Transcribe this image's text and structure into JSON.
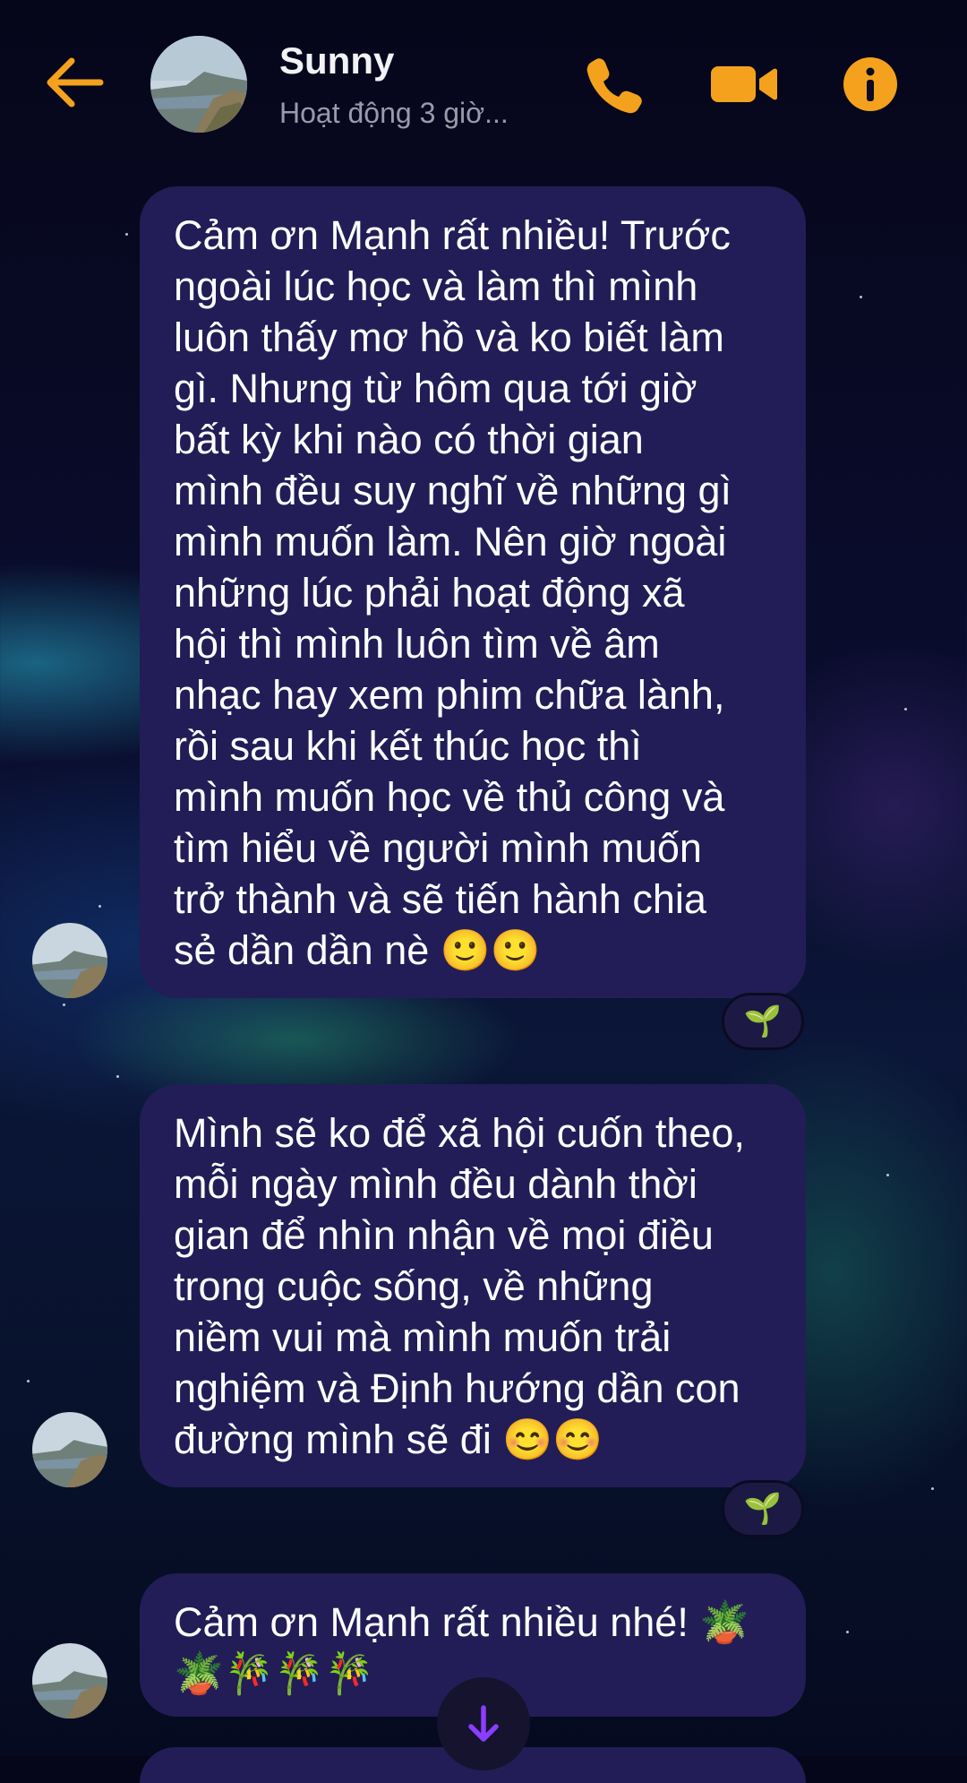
{
  "theme": {
    "accent": "#f4a11d",
    "bubble": "#221d57",
    "scroll_arrow": "#8b3dff"
  },
  "header": {
    "name": "Sunny",
    "status": "Hoạt động 3 giờ...",
    "icons": [
      "back-arrow-icon",
      "phone-icon",
      "video-camera-icon",
      "info-icon"
    ]
  },
  "messages": [
    {
      "text": "Cảm ơn Mạnh rất nhiều! Trước\nngoài lúc học và làm thì mình\nluôn thấy mơ hồ và ko biết làm\ngì. Nhưng từ hôm qua tới giờ\nbất kỳ khi nào có thời gian\nmình đều suy nghĩ về những gì\nmình muốn làm. Nên giờ ngoài\nnhững lúc phải hoạt động xã\nhội thì mình luôn tìm về âm\nnhạc hay xem phim chữa lành,\nrồi sau khi kết thúc học thì\nmình muốn học về thủ công và\ntìm hiểu về người mình muốn\ntrở thành và sẽ tiến hành chia\nsẻ dần dần nè 🙂🙂",
      "reaction": "🌱"
    },
    {
      "text": "Mình sẽ ko để xã hội cuốn theo,\nmỗi ngày mình đều dành thời\ngian để nhìn nhận về mọi điều\ntrong cuộc sống, về những\nniềm vui mà mình muốn trải\nnghiệm và Định hướng dần con\nđường mình sẽ đi 😊😊",
      "reaction": "🌱"
    },
    {
      "text": "Cảm ơn Mạnh rất nhiều nhé! 🪴\n🪴🎋🎋🎋"
    }
  ],
  "scroll_button": {
    "icon": "arrow-down-icon"
  }
}
